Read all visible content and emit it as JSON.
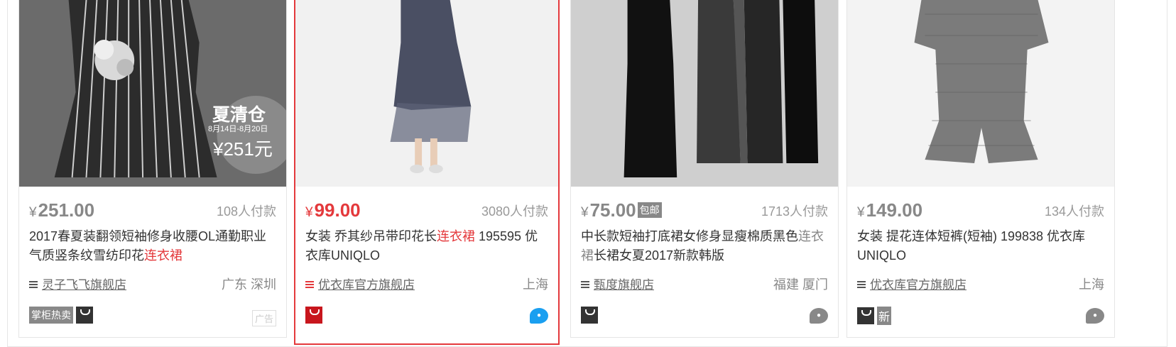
{
  "cards": [
    {
      "price": "251.00",
      "currency": "¥",
      "deals": "108人付款",
      "title_pre": "2017春夏装翻领短袖修身收腰OL通勤职业气质竖条纹雪纺印花",
      "title_hl": "连衣裙",
      "title_post": "",
      "shop": "灵子飞飞旗舰店",
      "location": "广东 深圳",
      "badge": "掌柜热卖",
      "ad": "广告",
      "promo_big": "夏清仓",
      "promo_date": "8月14日-8月20日",
      "promo_price": "¥251元"
    },
    {
      "price": "99.00",
      "currency": "¥",
      "deals": "3080人付款",
      "title_pre": "女装 乔其纱吊带印花长",
      "title_hl": "连衣裙",
      "title_post": " 195595 优衣库UNIQLO",
      "shop": "优衣库官方旗舰店",
      "location": "上海"
    },
    {
      "price": "75.00",
      "currency": "¥",
      "baoyou": "包邮",
      "deals": "1713人付款",
      "title_pre": "中长款短袖打底裙女修身显瘦棉质黑色",
      "title_hl": "连衣裙",
      "title_post": "长裙女夏2017新款韩版",
      "shop": "甄度旗舰店",
      "location": "福建 厦门"
    },
    {
      "price": "149.00",
      "currency": "¥",
      "deals": "134人付款",
      "title_pre": "女装 提花连体短裤(短袖) 199838 优衣库UNIQLO",
      "title_hl": "",
      "title_post": "",
      "shop": "优衣库官方旗舰店",
      "location": "上海",
      "badge_new": "新"
    }
  ]
}
